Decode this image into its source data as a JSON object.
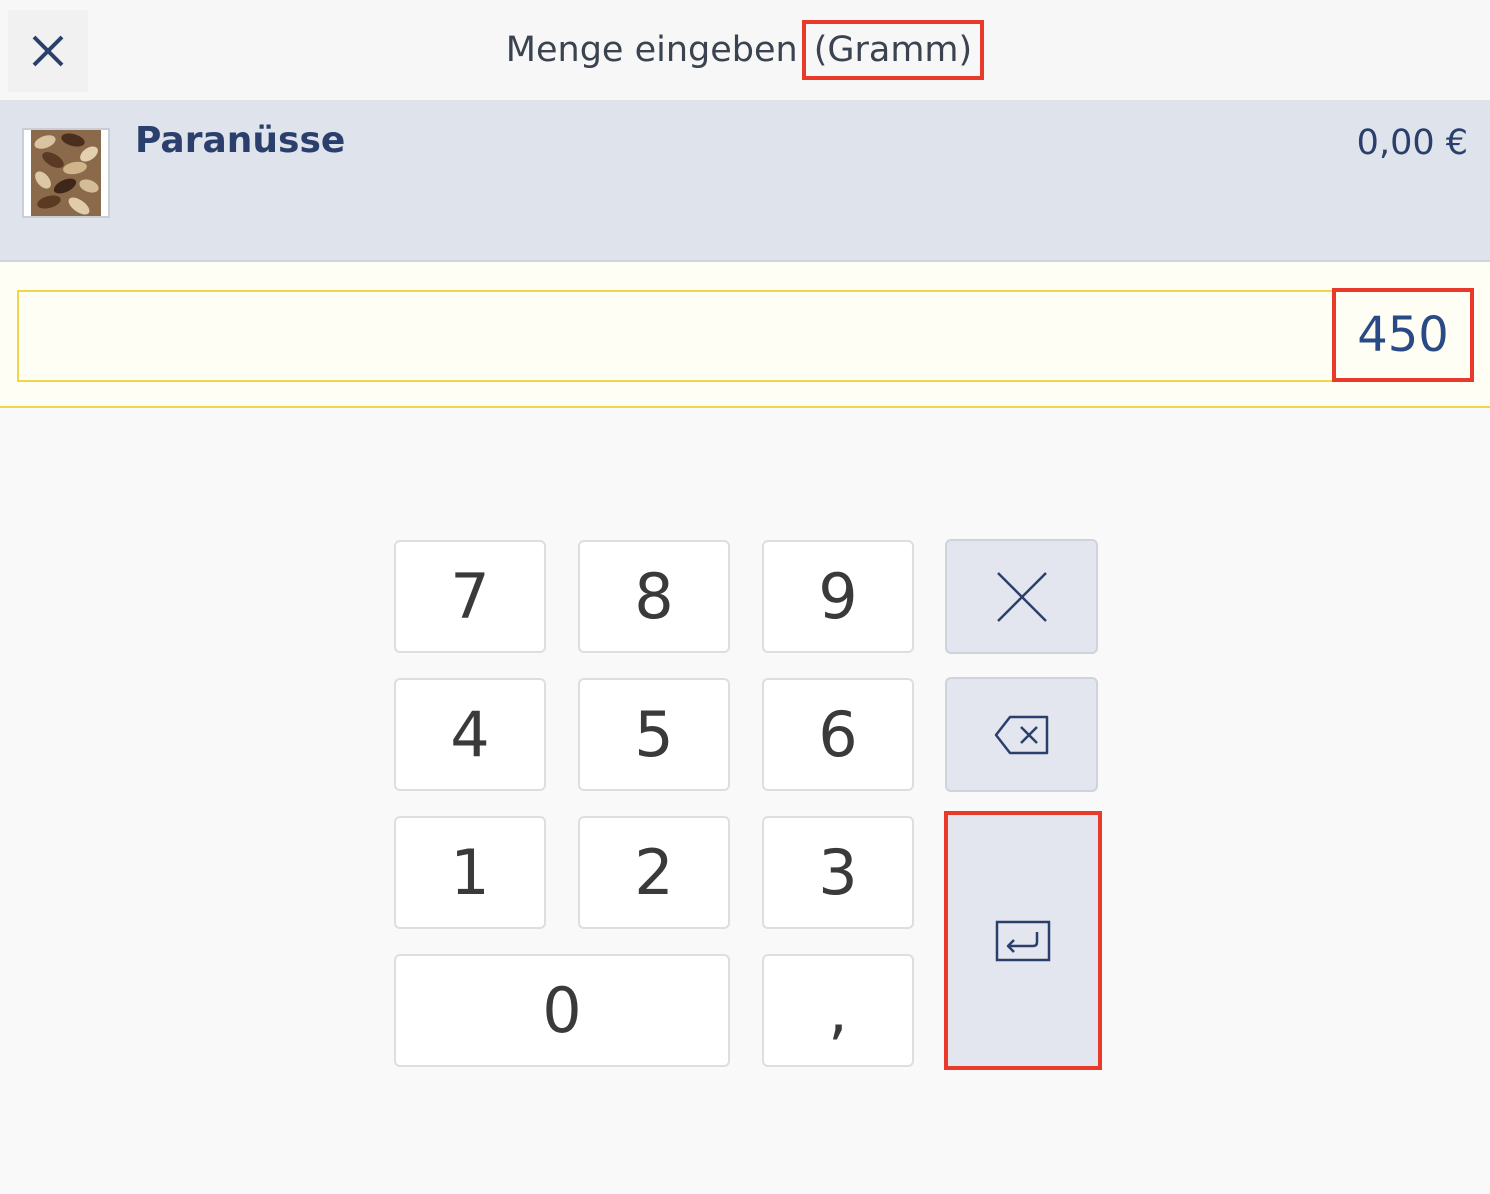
{
  "header": {
    "title": "Menge eingeben",
    "unit": "(Gramm)",
    "close_icon": "close-icon"
  },
  "product": {
    "name": "Paranüsse",
    "price": "0,00 €",
    "image_icon": "brazil-nuts-thumbnail"
  },
  "input": {
    "value": "450"
  },
  "keypad": {
    "keys": {
      "k7": "7",
      "k8": "8",
      "k9": "9",
      "k4": "4",
      "k5": "5",
      "k6": "6",
      "k1": "1",
      "k2": "2",
      "k3": "3",
      "k0": "0",
      "comma": ","
    },
    "clear_icon": "clear-x-icon",
    "backspace_icon": "backspace-icon",
    "enter_icon": "enter-return-icon"
  },
  "colors": {
    "accent_blue": "#2a3f6c",
    "highlight_red": "#e8392b",
    "input_border_yellow": "#f0d74a",
    "product_row_bg": "#dfe3eb"
  }
}
